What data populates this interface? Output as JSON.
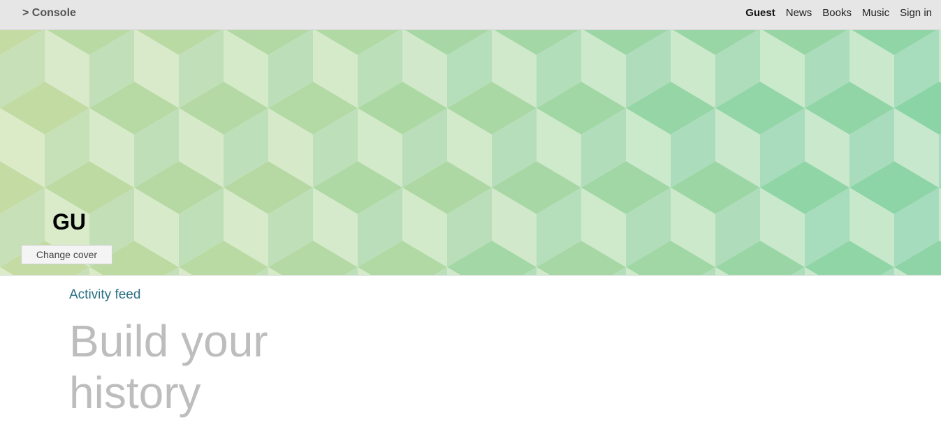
{
  "header": {
    "brand": "> Console",
    "nav": {
      "guest": "Guest",
      "news": "News",
      "books": "Books",
      "music": "Music",
      "sign_in": "Sign in"
    }
  },
  "cover": {
    "initials": "GU",
    "change_cover_label": "Change cover",
    "palette": [
      "#dcebc8",
      "#c5ddb0",
      "#d2e8cc",
      "#b3dfbe",
      "#a3d4a5",
      "#8ad4a8",
      "#a2dcbd",
      "#c8e8cf",
      "#6ccaa6"
    ]
  },
  "main": {
    "feed_link": "Activity feed",
    "hero_line1": "Build your",
    "hero_line2": "history"
  }
}
